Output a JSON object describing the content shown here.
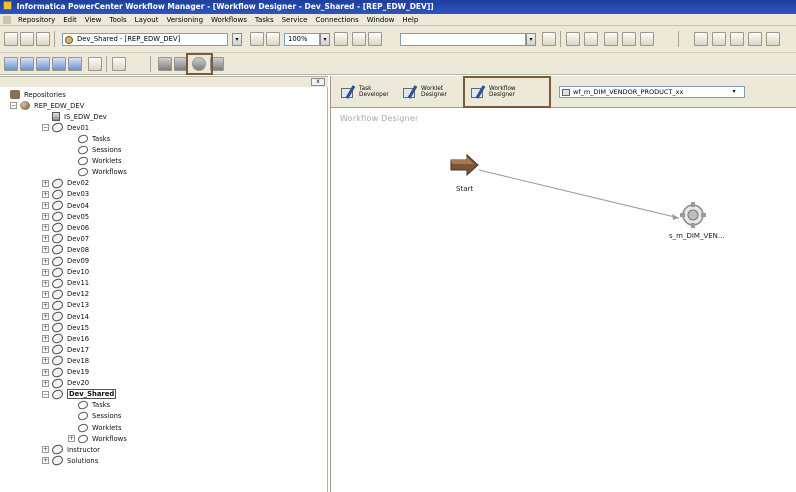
{
  "window": {
    "title": "Informatica PowerCenter Workflow Manager - [Workflow Designer - Dev_Shared - [REP_EDW_DEV]]"
  },
  "menu": {
    "items": [
      "Repository",
      "Edit",
      "View",
      "Tools",
      "Layout",
      "Versioning",
      "Workflows",
      "Tasks",
      "Service",
      "Connections",
      "Window",
      "Help"
    ]
  },
  "toolbar": {
    "folder_combo_value": "Dev_Shared - [REP_EDW_DEV]",
    "zoom_value": "100%",
    "combo_arrow": "▾"
  },
  "navigator": {
    "close_glyph": "x",
    "collapse_glyph": "−",
    "expand_glyph": "+",
    "tree": {
      "root": "Repositories",
      "repository": "REP_EDW_DEV",
      "integration_service": "IS_EDW_Dev",
      "dev01": {
        "label": "Dev01",
        "children": [
          "Tasks",
          "Sessions",
          "Worklets",
          "Workflows"
        ]
      },
      "folders": [
        "Dev02",
        "Dev03",
        "Dev04",
        "Dev05",
        "Dev06",
        "Dev07",
        "Dev08",
        "Dev09",
        "Dev10",
        "Dev11",
        "Dev12",
        "Dev13",
        "Dev14",
        "Dev15",
        "Dev16",
        "Dev17",
        "Dev18",
        "Dev19",
        "Dev20"
      ],
      "dev_shared": {
        "label": "Dev_Shared",
        "children": [
          "Tasks",
          "Sessions",
          "Worklets",
          "Workflows"
        ]
      },
      "trailing_folders": [
        "Instructor",
        "Solutions"
      ]
    }
  },
  "workspace": {
    "tabs": [
      {
        "line1": "Task",
        "line2": "Developer"
      },
      {
        "line1": "Worklet",
        "line2": "Designer"
      },
      {
        "line1": "Workflow",
        "line2": "Designer"
      }
    ],
    "workflow_combo_value": "wf_m_DIM_VENDOR_PRODUCT_xx",
    "canvas_title": "Workflow Designer",
    "start_label": "Start",
    "session_label": "s_m_DIM_VEN..."
  },
  "colors": {
    "highlight_border": "#7b5a3b",
    "title_bar": "#2b55c0",
    "chrome": "#ece9d8"
  }
}
